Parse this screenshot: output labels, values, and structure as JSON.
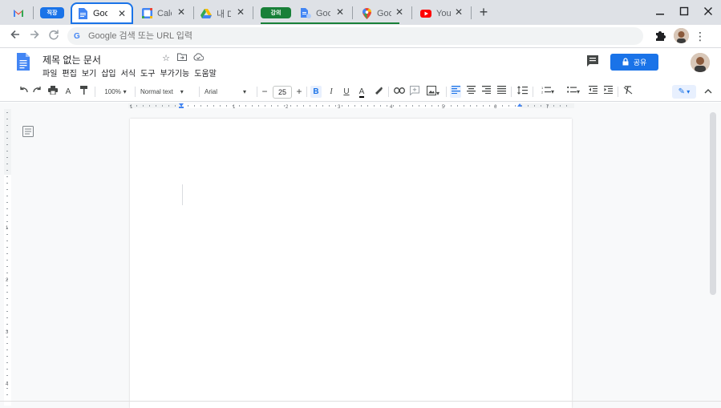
{
  "browser": {
    "tabs": [
      {
        "label": "Goo",
        "icon": "google-docs-icon"
      },
      {
        "label": "Cale",
        "icon": "google-calendar-icon"
      },
      {
        "label": "내 D",
        "icon": "google-drive-icon"
      },
      {
        "label": "Goo",
        "icon": "google-docs-blue-icon"
      },
      {
        "label": "Goo",
        "icon": "google-maps-icon"
      },
      {
        "label": "You",
        "icon": "youtube-icon"
      }
    ],
    "groups": [
      {
        "label": "직장",
        "color": "#1a73e8"
      },
      {
        "label": "강의",
        "color": "#188038"
      }
    ],
    "address_placeholder": "Google 검색 또는 URL 입력"
  },
  "docs": {
    "title": "제목 없는 문서",
    "menus": [
      "파일",
      "편집",
      "보기",
      "삽입",
      "서식",
      "도구",
      "부가기능",
      "도움말"
    ],
    "share_label": "공유",
    "toolbar": {
      "zoom": "100%",
      "style": "Normal text",
      "font": "Arial",
      "font_size": "25"
    },
    "ruler_marks": [
      "1",
      "1",
      "2",
      "3",
      "4",
      "5",
      "6",
      "7"
    ],
    "vruler_marks": [
      "1",
      "2",
      "3",
      "4"
    ]
  },
  "colors": {
    "accent": "#1a73e8",
    "tabstrip": "#dee1e6",
    "group_green": "#188038"
  }
}
